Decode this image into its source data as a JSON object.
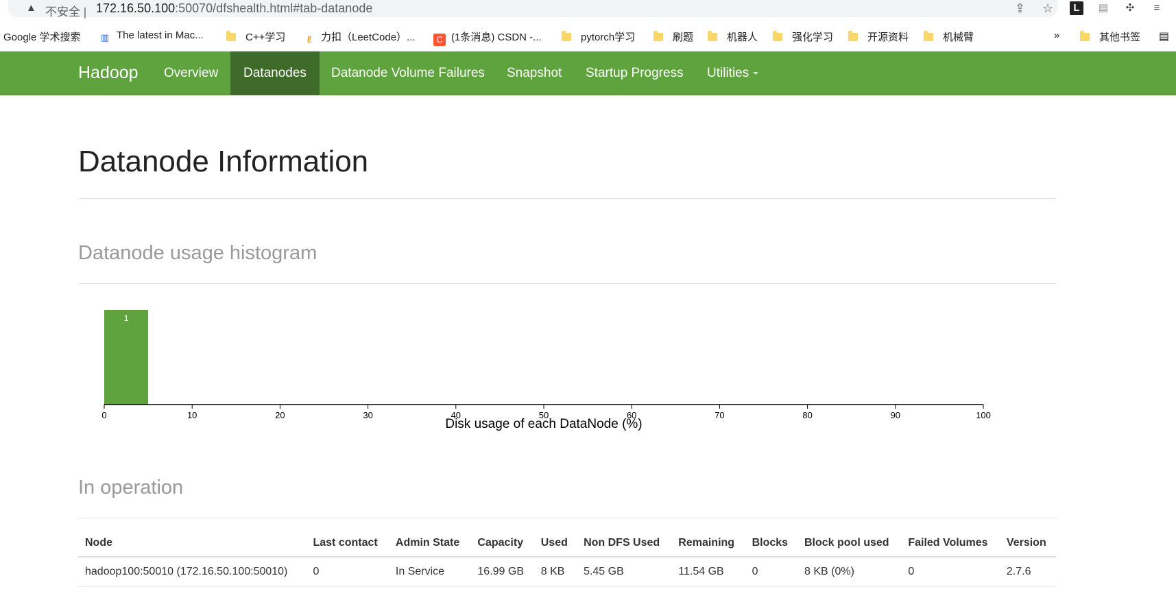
{
  "browser": {
    "insecure_label": "不安全",
    "url_host": "172.16.50.100",
    "url_rest": ":50070/dfshealth.html#tab-datanode",
    "bookmarks": [
      "Google 学术搜索",
      "The latest in Mac...",
      "C++学习",
      "力扣（LeetCode）...",
      "(1条消息) CSDN -...",
      "pytorch学习",
      "刷题",
      "机器人",
      "强化学习",
      "开源资料",
      "机械臂"
    ],
    "more_bookmarks": "»",
    "other_bookmarks": "其他书签"
  },
  "navbar": {
    "brand": "Hadoop",
    "items": [
      "Overview",
      "Datanodes",
      "Datanode Volume Failures",
      "Snapshot",
      "Startup Progress",
      "Utilities"
    ],
    "active_index": 1
  },
  "page": {
    "title": "Datanode Information",
    "histogram_heading": "Datanode usage histogram",
    "operation_heading": "In operation"
  },
  "chart_data": {
    "type": "bar",
    "xlabel": "Disk usage of each DataNode (%)",
    "xlim": [
      0,
      100
    ],
    "xticks": [
      0,
      10,
      20,
      30,
      40,
      50,
      60,
      70,
      80,
      90,
      100
    ],
    "bins": [
      {
        "x0": 0,
        "x1": 5,
        "count": 1
      }
    ],
    "bar_color": "#5fa33e"
  },
  "table": {
    "columns": [
      "Node",
      "Last contact",
      "Admin State",
      "Capacity",
      "Used",
      "Non DFS Used",
      "Remaining",
      "Blocks",
      "Block pool used",
      "Failed Volumes",
      "Version"
    ],
    "rows": [
      [
        "hadoop100:50010 (172.16.50.100:50010)",
        "0",
        "In Service",
        "16.99 GB",
        "8 KB",
        "5.45 GB",
        "11.54 GB",
        "0",
        "8 KB (0%)",
        "0",
        "2.7.6"
      ]
    ]
  }
}
